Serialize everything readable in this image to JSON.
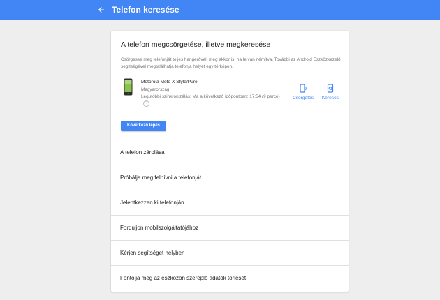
{
  "topbar": {
    "title": "Telefon keresése",
    "back_icon": "arrow-back-icon",
    "color": "#4285f4"
  },
  "card": {
    "title": "A telefon megcsörgetése, illetve megkeresése",
    "description": "Csörgesse meg telefonját teljes hangerővel, még akkor is, ha le van némítva. További az Android Eszközkezelő segítségével megtalálhatja telefonja helyét egy térképen.",
    "device": {
      "name": "Motorola Moto X Style/Pure",
      "country": "Magyarország",
      "sync": "Legutóbbi szinkronizálás: Ma a következő időpontban: 17:54 (9 perce)",
      "image_icon": "phone-icon",
      "help_icon": "help-icon"
    },
    "actions": [
      {
        "label": "Csörgetés",
        "icon": "ring-phone-icon"
      },
      {
        "label": "Keresés",
        "icon": "locate-phone-icon"
      }
    ],
    "next_button": "Következő lépés",
    "options": [
      "A telefon zárolása",
      "Próbálja meg felhívni a telefonját",
      "Jelentkezzen ki telefonján",
      "Forduljon mobilszolgáltatójához",
      "Kérjen segítséget helyben",
      "Fontolja meg az eszközön szereplő adatok törlését"
    ]
  }
}
